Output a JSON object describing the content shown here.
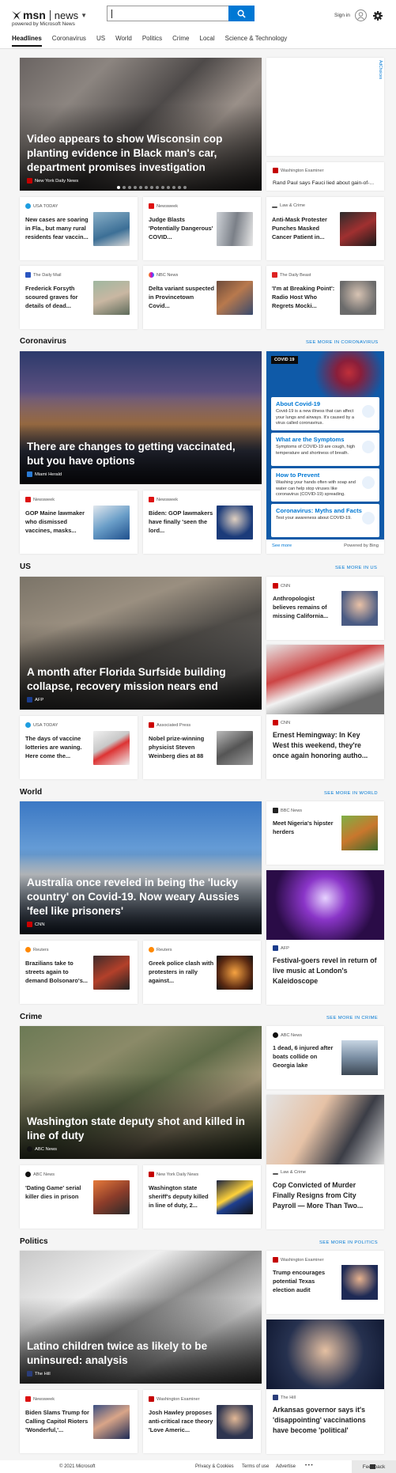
{
  "header": {
    "brand": "msn",
    "product": "news",
    "powered_by": "powered by Microsoft News",
    "search": {
      "value": "",
      "placeholder": ""
    },
    "sign_in": "Sign in"
  },
  "nav": {
    "items": [
      "Headlines",
      "Coronavirus",
      "US",
      "World",
      "Politics",
      "Crime",
      "Local",
      "Science & Technology"
    ],
    "active": "Headlines"
  },
  "ad_label": "AdChoices",
  "headlines": {
    "hero": {
      "title": "Video appears to show Wisconsin cop planting evidence in Black man's car, department promises investigation",
      "source": "New York Daily News",
      "slides": 13,
      "active_slide": 0
    },
    "side": {
      "source": "Washington Examiner",
      "title": "Rand Paul says Fauci lied about gain-of-..."
    },
    "row1": [
      {
        "source": "USA TODAY",
        "title": "New cases are soaring in Fla., but many rural residents fear vaccin..."
      },
      {
        "source": "Newsweek",
        "title": "Judge Blasts 'Potentially Dangerous' COVID..."
      },
      {
        "source": "Law & Crime",
        "title": "Anti-Mask Protester Punches Masked Cancer Patient in..."
      }
    ],
    "row2": [
      {
        "source": "The Daily Mail",
        "title": "Frederick Forsyth scoured graves for details of dead..."
      },
      {
        "source": "NBC News",
        "title": "Delta variant suspected in Provincetown Covid..."
      },
      {
        "source": "The Daily Beast",
        "title": "'I'm at Breaking Point': Radio Host Who Regrets Mocki..."
      }
    ]
  },
  "coronavirus": {
    "section": "Coronavirus",
    "see_more": "SEE MORE IN CORONAVIRUS",
    "hero": {
      "title": "There are changes to getting vaccinated, but you have options",
      "source": "Miami Herald"
    },
    "row": [
      {
        "source": "Newsweek",
        "title": "GOP Maine lawmaker who dismissed vaccines, masks..."
      },
      {
        "source": "Newsweek",
        "title": "Biden: GOP lawmakers have finally 'seen the lord..."
      }
    ],
    "panel": {
      "badge": "COVID 19",
      "items": [
        {
          "title": "About Covid-19",
          "desc": "Covid-19 is a new illness that can affect your lungs and airways. It's caused by a virus called coronavirus."
        },
        {
          "title": "What are the Symptoms",
          "desc": "Symptoms of COVID-19 are cough, high temperature and shortness of breath."
        },
        {
          "title": "How to Prevent",
          "desc": "Washing your hands often with soap and water can help stop viruses like coronavirus (COVID-19) spreading."
        },
        {
          "title": "Coronavirus: Myths and Facts",
          "desc": "Test your awareness about COVID-19."
        }
      ],
      "see_more": "See more",
      "powered": "Powered by Bing"
    }
  },
  "us": {
    "section": "US",
    "see_more": "SEE MORE IN US",
    "hero": {
      "title": "A month after Florida Surfside building collapse, recovery mission nears end",
      "source": "AFP"
    },
    "side_top": {
      "source": "CNN",
      "title": "Anthropologist believes remains of missing California..."
    },
    "side_tall": {
      "source": "CNN",
      "title": "Ernest Hemingway: In Key West this weekend, they're once again honoring autho..."
    },
    "row": [
      {
        "source": "USA TODAY",
        "title": "The days of vaccine lotteries are waning. Here come the..."
      },
      {
        "source": "Associated Press",
        "title": "Nobel prize-winning physicist Steven Weinberg dies at 88"
      }
    ]
  },
  "world": {
    "section": "World",
    "see_more": "SEE MORE IN WORLD",
    "hero": {
      "title": "Australia once reveled in being the 'lucky country' on Covid-19. Now weary Aussies 'feel like prisoners'",
      "source": "CNN"
    },
    "side_top": {
      "source": "BBC News",
      "title": "Meet Nigeria's hipster herders"
    },
    "side_tall": {
      "source": "AFP",
      "title": "Festival-goers revel in return of live music at London's Kaleidoscope"
    },
    "row": [
      {
        "source": "Reuters",
        "title": "Brazilians take to streets again to demand Bolsonaro's..."
      },
      {
        "source": "Reuters",
        "title": "Greek police clash with protesters in rally against..."
      }
    ]
  },
  "crime": {
    "section": "Crime",
    "see_more": "SEE MORE IN CRIME",
    "hero": {
      "title": "Washington state deputy shot and killed in line of duty",
      "source": "ABC News"
    },
    "side_top": {
      "source": "ABC News",
      "title": "1 dead, 6 injured after boats collide on Georgia lake"
    },
    "side_tall": {
      "source": "Law & Crime",
      "title": "Cop Convicted of Murder Finally Resigns from City Payroll — More Than Two..."
    },
    "row": [
      {
        "source": "ABC News",
        "title": "'Dating Game' serial killer dies in prison"
      },
      {
        "source": "New York Daily News",
        "title": "Washington state sheriff's deputy killed in line of duty, 2..."
      }
    ]
  },
  "politics": {
    "section": "Politics",
    "see_more": "SEE MORE IN POLITICS",
    "hero": {
      "title": "Latino children twice as likely to be uninsured: analysis",
      "source": "The Hill"
    },
    "side_top": {
      "source": "Washington Examiner",
      "title": "Trump encourages potential Texas election audit"
    },
    "side_tall": {
      "source": "The Hill",
      "title": "Arkansas governor says it's 'disappointing' vaccinations have become 'political'"
    },
    "row": [
      {
        "source": "Newsweek",
        "title": "Biden Slams Trump for Calling Capitol Rioters 'Wonderful,'..."
      },
      {
        "source": "Washington Examiner",
        "title": "Josh Hawley proposes anti-critical race theory 'Love Americ..."
      }
    ]
  },
  "footer": {
    "copyright": "© 2021 Microsoft",
    "links": [
      "Privacy & Cookies",
      "Terms of use",
      "Advertise"
    ],
    "more": "• • •",
    "feedback": "Feedback"
  },
  "colors": {
    "accent": "#0078d4",
    "covid_panel": "#0f5aa8"
  }
}
